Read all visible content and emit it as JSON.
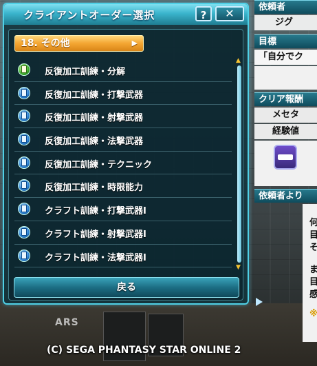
{
  "window": {
    "title": "クライアントオーダー選択",
    "help_label": "?",
    "close_label": "✕"
  },
  "category": {
    "label": "18. その他"
  },
  "orders": [
    {
      "label": "反復加工訓練・分解",
      "status": "completed"
    },
    {
      "label": "反復加工訓練・打撃武器",
      "status": "available"
    },
    {
      "label": "反復加工訓練・射撃武器",
      "status": "available"
    },
    {
      "label": "反復加工訓練・法撃武器",
      "status": "available"
    },
    {
      "label": "反復加工訓練・テクニック",
      "status": "available"
    },
    {
      "label": "反復加工訓練・時限能力",
      "status": "available"
    },
    {
      "label": "クラフト訓練・打撃武器Ⅰ",
      "status": "available"
    },
    {
      "label": "クラフト訓練・射撃武器Ⅰ",
      "status": "available"
    },
    {
      "label": "クラフト訓練・法撃武器Ⅰ",
      "status": "available"
    }
  ],
  "back_button": {
    "label": "戻る"
  },
  "side_panel": {
    "client_header": "依頼者",
    "client_name": "ジグ",
    "objective_header": "目標",
    "objective_text": "「自分でク",
    "reward_header": "クリア報酬",
    "reward_meseta": "メセタ",
    "reward_exp": "経験値",
    "from_client_header": "依頼者より",
    "from_client_lines": [
      "何",
      "目",
      "そ",
      "ま",
      "目",
      "感",
      "※"
    ]
  },
  "background": {
    "floor_tag": "ARS"
  },
  "footer": {
    "copyright": "(C) SEGA  PHANTASY STAR ONLINE 2"
  },
  "colors": {
    "accent": "#4fd0e6",
    "category": "#f4a632",
    "panel_bg": "#12343e"
  }
}
